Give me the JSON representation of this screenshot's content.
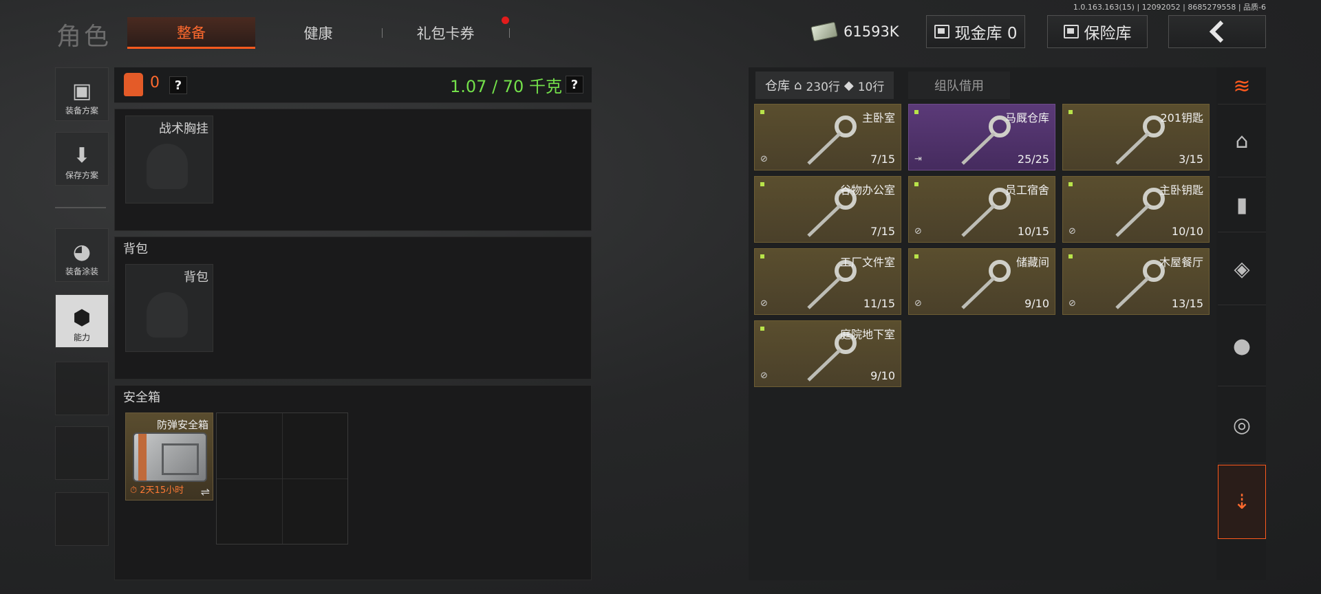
{
  "version": "1.0.163.163(15) | 12092052 | 8685279558 | 品质-6",
  "title": "角色",
  "tabs": [
    {
      "label": "整备",
      "active": true
    },
    {
      "label": "健康",
      "active": false
    },
    {
      "label": "礼包卡券",
      "active": false,
      "has_notification": true
    }
  ],
  "header": {
    "money": "61593K",
    "cash_box_label": "现金库 0",
    "safe_label": "保险库",
    "back_icon": "back-chevron-icon"
  },
  "left_rail": [
    {
      "label": "装备方案",
      "icon": "vest-icon"
    },
    {
      "label": "保存方案",
      "icon": "download-icon"
    },
    {
      "label": "装备涂装",
      "icon": "helmet-icon"
    },
    {
      "label": "能力",
      "icon": "lightning-hex-icon",
      "active": true
    }
  ],
  "loadout": {
    "vest_count": "0",
    "weight": "1.07 / 70 千克",
    "help": "?",
    "chest_rig_slot": "战术胸挂",
    "backpack_section": "背包",
    "backpack_slot": "背包",
    "secure_section": "安全箱",
    "secure_item": {
      "name": "防弹安全箱",
      "timer": "2天15小时",
      "swap": "⇌"
    }
  },
  "storage": {
    "tab_label": "仓库",
    "rows": "230行",
    "keys_rows": "10行",
    "team_tab": "组队借用",
    "items": [
      {
        "name": "主卧室",
        "count": "7/15",
        "color": "gold",
        "badge": "no-sell"
      },
      {
        "name": "马厩仓库",
        "count": "25/25",
        "color": "purple",
        "badge": "exit"
      },
      {
        "name": "201钥匙",
        "count": "3/15",
        "color": "gold",
        "badge": ""
      },
      {
        "name": "谷物办公室",
        "count": "7/15",
        "color": "gold",
        "badge": ""
      },
      {
        "name": "员工宿舍",
        "count": "10/15",
        "color": "gold",
        "badge": "no-sell"
      },
      {
        "name": "主卧钥匙",
        "count": "10/10",
        "color": "gold",
        "badge": "no-sell"
      },
      {
        "name": "工厂文件室",
        "count": "11/15",
        "color": "gold",
        "badge": "no-sell"
      },
      {
        "name": "储藏间",
        "count": "9/10",
        "color": "gold",
        "badge": "no-sell"
      },
      {
        "name": "木屋餐厅",
        "count": "13/15",
        "color": "gold",
        "badge": "no-sell"
      },
      {
        "name": "庭院地下室",
        "count": "9/10",
        "color": "gold",
        "badge": "no-sell"
      }
    ]
  },
  "right_rail": [
    "layers-refresh-icon",
    "home-icon",
    "bullet-icon",
    "sight-icon",
    "grenade-icon",
    "tape-icon",
    "key-drop-icon"
  ]
}
